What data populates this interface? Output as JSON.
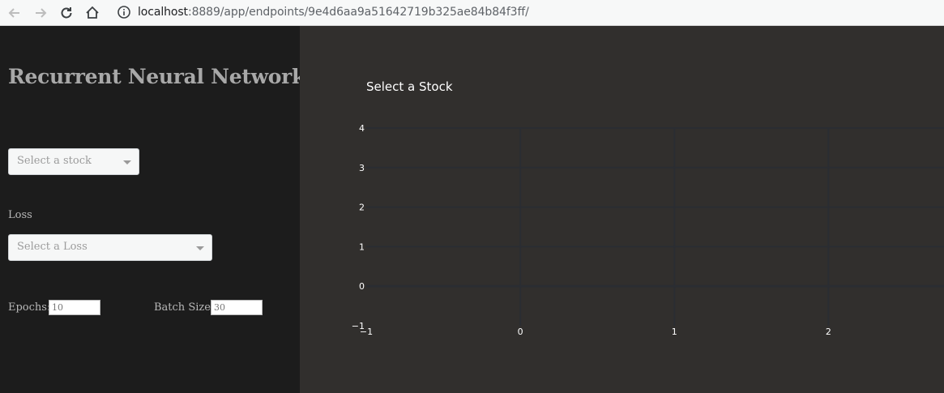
{
  "browser": {
    "url_host": "localhost",
    "url_rest": ":8889/app/endpoints/9e4d6aa9a51642719b325ae84b84f3ff/"
  },
  "sidebar": {
    "title": "Recurrent Neural Networks",
    "stock_select": {
      "placeholder": "Select a stock"
    },
    "loss_label": "Loss",
    "loss_select": {
      "placeholder": "Select a Loss"
    },
    "epochs_label": "Epochs:",
    "epochs_value": "10",
    "batch_label": "Batch Size:",
    "batch_value": "30"
  },
  "chart_data": {
    "type": "line",
    "title": "Select a Stock",
    "xlabel": "",
    "ylabel": "",
    "xlim": [
      -1,
      2.75
    ],
    "ylim": [
      -1,
      4
    ],
    "x_ticks": [
      -1,
      0,
      1,
      2
    ],
    "y_ticks": [
      -1,
      0,
      1,
      2,
      3,
      4
    ],
    "x_tick_labels": [
      "−1",
      "0",
      "1",
      "2"
    ],
    "y_tick_labels": [
      "−1",
      "0",
      "1",
      "2",
      "3",
      "4"
    ],
    "grid": true,
    "series": []
  },
  "colors": {
    "plot_bg": "#312f2d",
    "grid": "#2a2d32",
    "sidebar_bg": "#1c1c1c"
  }
}
